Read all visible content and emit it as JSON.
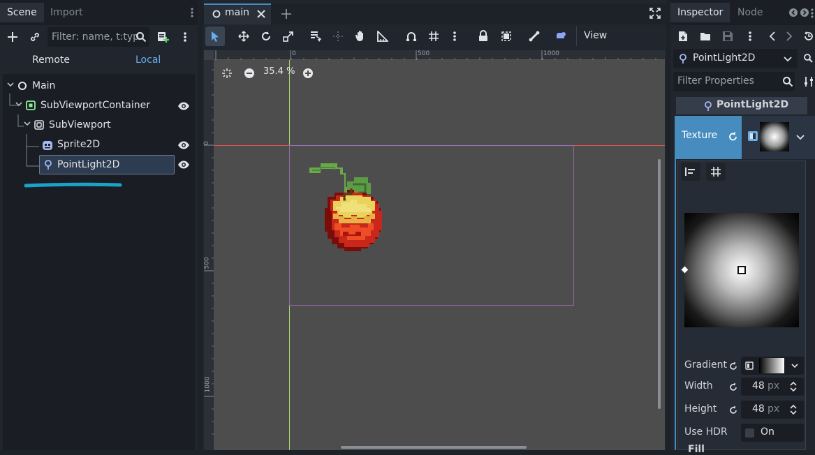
{
  "left_dock": {
    "tabs": [
      "Scene",
      "Import"
    ],
    "filter_placeholder": "Filter: name, t:typ",
    "remote_label": "Remote",
    "local_label": "Local",
    "tree": [
      {
        "label": "Main",
        "icon": "node-circle-icon"
      },
      {
        "label": "SubViewportContainer",
        "icon": "subviewport-container-icon"
      },
      {
        "label": "SubViewport",
        "icon": "subviewport-icon"
      },
      {
        "label": "Sprite2D",
        "icon": "sprite2d-icon"
      },
      {
        "label": "PointLight2D",
        "icon": "pointlight2d-icon"
      }
    ]
  },
  "center": {
    "tab_label": "main",
    "zoom_label": "35.4 %",
    "view_button": "View",
    "ruler_top_labels": [
      "0",
      "500",
      "1000"
    ],
    "ruler_left_labels": [
      "0",
      "500",
      "1000"
    ]
  },
  "right_dock": {
    "tabs": [
      "Inspector",
      "Node"
    ],
    "node_selector": "PointLight2D",
    "filter_placeholder": "Filter Properties",
    "section_title": "PointLight2D",
    "texture_label": "Texture",
    "props": {
      "gradient_label": "Gradient",
      "width_label": "Width",
      "width_value": "48",
      "height_label": "Height",
      "height_value": "48",
      "unit": "px",
      "hdr_label": "Use HDR",
      "hdr_value": "On",
      "fill_label": "Fill"
    }
  },
  "colors": {
    "accent": "#478cbf",
    "selected_bg": "#2d3c50",
    "underline": "#1aa3c8"
  }
}
